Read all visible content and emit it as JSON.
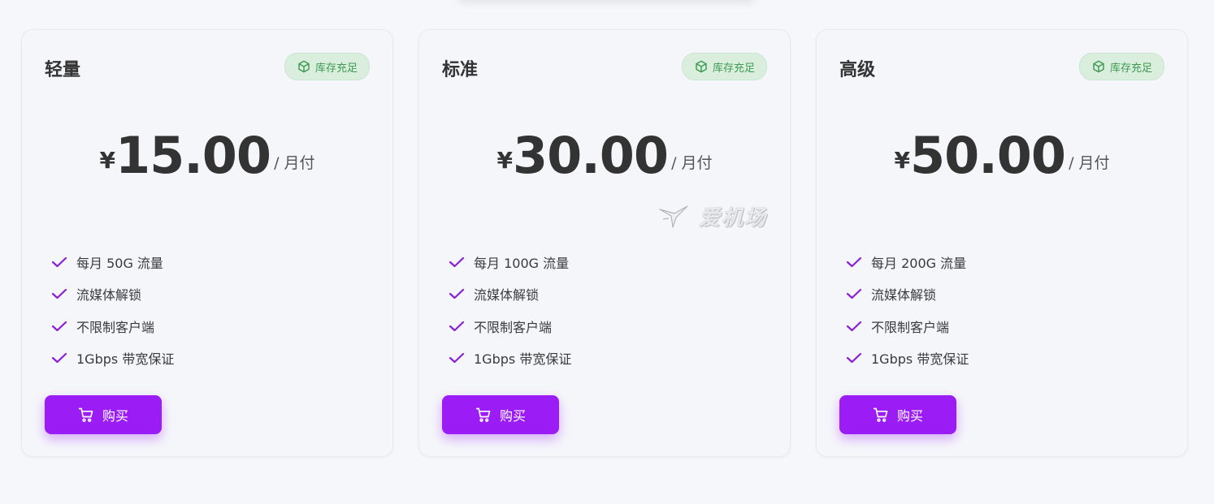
{
  "colors": {
    "accent": "#9b1cf5",
    "badge_bg": "#d9eedd",
    "badge_text": "#3e9a52",
    "check": "#8a1fd6"
  },
  "watermark": {
    "text": "爱机场"
  },
  "plans": [
    {
      "name": "轻量",
      "badge": "库存充足",
      "currency": "¥",
      "amount": "15.00",
      "period": "/ 月付",
      "features": [
        "每月 50G 流量",
        "流媒体解锁",
        "不限制客户端",
        "1Gbps 带宽保证"
      ],
      "button_label": "购买"
    },
    {
      "name": "标准",
      "badge": "库存充足",
      "currency": "¥",
      "amount": "30.00",
      "period": "/ 月付",
      "features": [
        "每月 100G 流量",
        "流媒体解锁",
        "不限制客户端",
        "1Gbps 带宽保证"
      ],
      "button_label": "购买"
    },
    {
      "name": "高级",
      "badge": "库存充足",
      "currency": "¥",
      "amount": "50.00",
      "period": "/ 月付",
      "features": [
        "每月 200G 流量",
        "流媒体解锁",
        "不限制客户端",
        "1Gbps 带宽保证"
      ],
      "button_label": "购买"
    }
  ]
}
